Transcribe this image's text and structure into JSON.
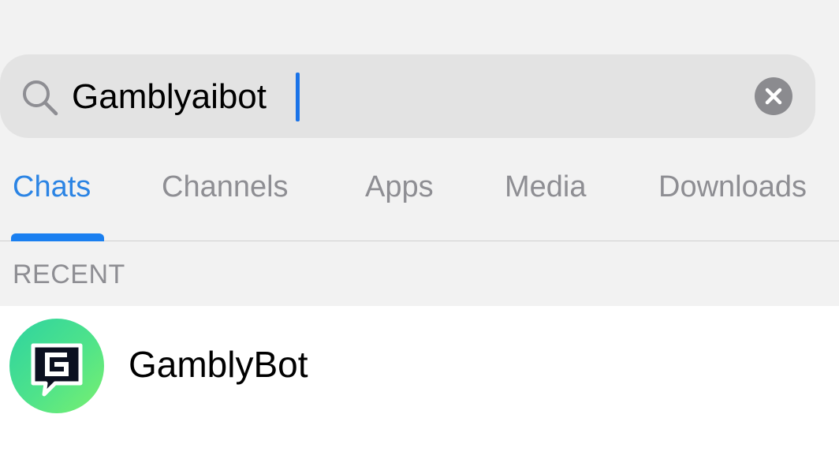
{
  "search": {
    "value": "Gamblyaibot",
    "icon": "search-icon",
    "clear_icon": "close-icon"
  },
  "tabs": [
    {
      "label": "Chats",
      "active": true
    },
    {
      "label": "Channels",
      "active": false
    },
    {
      "label": "Apps",
      "active": false
    },
    {
      "label": "Media",
      "active": false
    },
    {
      "label": "Downloads",
      "active": false
    }
  ],
  "section": {
    "title": "RECENT"
  },
  "results": [
    {
      "name": "GamblyBot",
      "avatar_icon": "gambly-logo-icon"
    }
  ],
  "colors": {
    "accent": "#2b84e4",
    "avatar_gradient_start": "#2ed3a0",
    "avatar_gradient_end": "#7af06f"
  }
}
